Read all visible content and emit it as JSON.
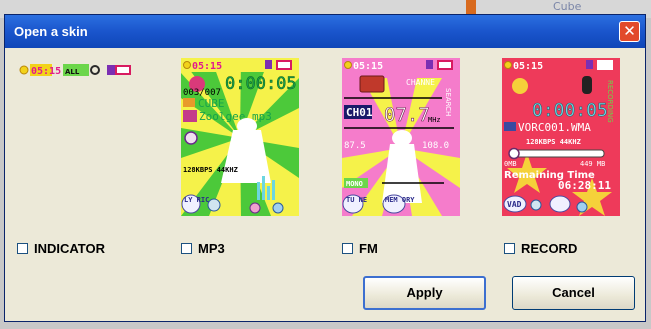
{
  "background": {
    "label": "Cube"
  },
  "window": {
    "title": "Open a skin",
    "close_glyph": "✕"
  },
  "skins": [
    {
      "label": "INDICATOR",
      "checked": false,
      "status_time": "05:15",
      "status_mode": "ALL",
      "colors": {
        "bg": "#ece9d8"
      }
    },
    {
      "label": "MP3",
      "checked": false,
      "status_time": "05:15",
      "track": "003/007",
      "time": "0:00:05",
      "folder": "CUBE",
      "file": "Zoolgee.mp3",
      "bitrate": "128KBPS 44KHZ",
      "btn_a": "LY RIC",
      "colors": {
        "bg": "#f5f24a",
        "ray": "#4cc93a"
      }
    },
    {
      "label": "FM",
      "checked": false,
      "status_time": "05:15",
      "channel_word": "CHANNE",
      "channel": "CH01",
      "freq": "07.7",
      "unit": "MHz",
      "min": "87.5",
      "max": "108.0",
      "mode": "MONO",
      "btn_a": "TU NE",
      "btn_b": "MEM ORY",
      "colors": {
        "bg": "#f57ccb",
        "ray": "#f5f24a"
      }
    },
    {
      "label": "RECORD",
      "checked": false,
      "status_time": "05:15",
      "time": "0:00:05",
      "file": "VORC001.WMA",
      "bitrate": "128KBPS 44KHZ",
      "min": "0MB",
      "max": "449 MB",
      "remaining_label": "Remaining Time",
      "remaining": "06:28:11",
      "btn_a": "VAD",
      "colors": {
        "bg": "#ee3a5a",
        "ray": "#f5d13a"
      }
    }
  ],
  "buttons": {
    "apply": "Apply",
    "cancel": "Cancel"
  }
}
